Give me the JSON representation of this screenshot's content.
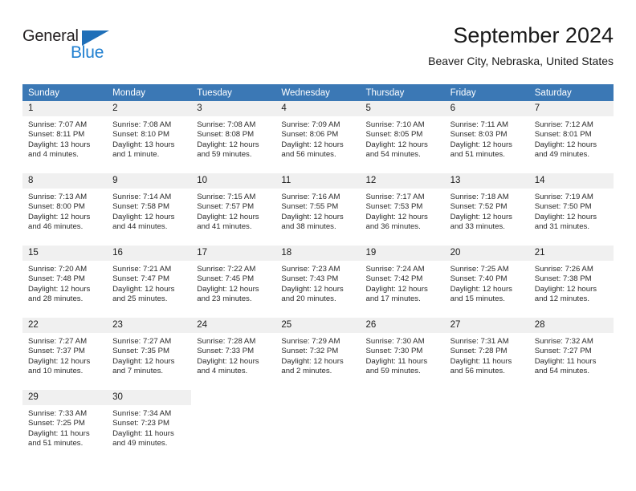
{
  "brand": {
    "name_part1": "General",
    "name_part2": "Blue",
    "triangle_icon": "blue-triangle-icon",
    "accent_color": "#1f7fd0"
  },
  "header": {
    "title": "September 2024",
    "subtitle": "Beaver City, Nebraska, United States"
  },
  "theme": {
    "header_row_bg": "#3b78b5",
    "daynum_band_bg": "#f0f0f0",
    "page_bg": "#ffffff",
    "text_color": "#1a1a1a"
  },
  "weekdays": [
    "Sunday",
    "Monday",
    "Tuesday",
    "Wednesday",
    "Thursday",
    "Friday",
    "Saturday"
  ],
  "calendar": {
    "weeks": [
      [
        {
          "day": "1",
          "sunrise": "Sunrise: 7:07 AM",
          "sunset": "Sunset: 8:11 PM",
          "daylight_line1": "Daylight: 13 hours",
          "daylight_line2": "and 4 minutes."
        },
        {
          "day": "2",
          "sunrise": "Sunrise: 7:08 AM",
          "sunset": "Sunset: 8:10 PM",
          "daylight_line1": "Daylight: 13 hours",
          "daylight_line2": "and 1 minute."
        },
        {
          "day": "3",
          "sunrise": "Sunrise: 7:08 AM",
          "sunset": "Sunset: 8:08 PM",
          "daylight_line1": "Daylight: 12 hours",
          "daylight_line2": "and 59 minutes."
        },
        {
          "day": "4",
          "sunrise": "Sunrise: 7:09 AM",
          "sunset": "Sunset: 8:06 PM",
          "daylight_line1": "Daylight: 12 hours",
          "daylight_line2": "and 56 minutes."
        },
        {
          "day": "5",
          "sunrise": "Sunrise: 7:10 AM",
          "sunset": "Sunset: 8:05 PM",
          "daylight_line1": "Daylight: 12 hours",
          "daylight_line2": "and 54 minutes."
        },
        {
          "day": "6",
          "sunrise": "Sunrise: 7:11 AM",
          "sunset": "Sunset: 8:03 PM",
          "daylight_line1": "Daylight: 12 hours",
          "daylight_line2": "and 51 minutes."
        },
        {
          "day": "7",
          "sunrise": "Sunrise: 7:12 AM",
          "sunset": "Sunset: 8:01 PM",
          "daylight_line1": "Daylight: 12 hours",
          "daylight_line2": "and 49 minutes."
        }
      ],
      [
        {
          "day": "8",
          "sunrise": "Sunrise: 7:13 AM",
          "sunset": "Sunset: 8:00 PM",
          "daylight_line1": "Daylight: 12 hours",
          "daylight_line2": "and 46 minutes."
        },
        {
          "day": "9",
          "sunrise": "Sunrise: 7:14 AM",
          "sunset": "Sunset: 7:58 PM",
          "daylight_line1": "Daylight: 12 hours",
          "daylight_line2": "and 44 minutes."
        },
        {
          "day": "10",
          "sunrise": "Sunrise: 7:15 AM",
          "sunset": "Sunset: 7:57 PM",
          "daylight_line1": "Daylight: 12 hours",
          "daylight_line2": "and 41 minutes."
        },
        {
          "day": "11",
          "sunrise": "Sunrise: 7:16 AM",
          "sunset": "Sunset: 7:55 PM",
          "daylight_line1": "Daylight: 12 hours",
          "daylight_line2": "and 38 minutes."
        },
        {
          "day": "12",
          "sunrise": "Sunrise: 7:17 AM",
          "sunset": "Sunset: 7:53 PM",
          "daylight_line1": "Daylight: 12 hours",
          "daylight_line2": "and 36 minutes."
        },
        {
          "day": "13",
          "sunrise": "Sunrise: 7:18 AM",
          "sunset": "Sunset: 7:52 PM",
          "daylight_line1": "Daylight: 12 hours",
          "daylight_line2": "and 33 minutes."
        },
        {
          "day": "14",
          "sunrise": "Sunrise: 7:19 AM",
          "sunset": "Sunset: 7:50 PM",
          "daylight_line1": "Daylight: 12 hours",
          "daylight_line2": "and 31 minutes."
        }
      ],
      [
        {
          "day": "15",
          "sunrise": "Sunrise: 7:20 AM",
          "sunset": "Sunset: 7:48 PM",
          "daylight_line1": "Daylight: 12 hours",
          "daylight_line2": "and 28 minutes."
        },
        {
          "day": "16",
          "sunrise": "Sunrise: 7:21 AM",
          "sunset": "Sunset: 7:47 PM",
          "daylight_line1": "Daylight: 12 hours",
          "daylight_line2": "and 25 minutes."
        },
        {
          "day": "17",
          "sunrise": "Sunrise: 7:22 AM",
          "sunset": "Sunset: 7:45 PM",
          "daylight_line1": "Daylight: 12 hours",
          "daylight_line2": "and 23 minutes."
        },
        {
          "day": "18",
          "sunrise": "Sunrise: 7:23 AM",
          "sunset": "Sunset: 7:43 PM",
          "daylight_line1": "Daylight: 12 hours",
          "daylight_line2": "and 20 minutes."
        },
        {
          "day": "19",
          "sunrise": "Sunrise: 7:24 AM",
          "sunset": "Sunset: 7:42 PM",
          "daylight_line1": "Daylight: 12 hours",
          "daylight_line2": "and 17 minutes."
        },
        {
          "day": "20",
          "sunrise": "Sunrise: 7:25 AM",
          "sunset": "Sunset: 7:40 PM",
          "daylight_line1": "Daylight: 12 hours",
          "daylight_line2": "and 15 minutes."
        },
        {
          "day": "21",
          "sunrise": "Sunrise: 7:26 AM",
          "sunset": "Sunset: 7:38 PM",
          "daylight_line1": "Daylight: 12 hours",
          "daylight_line2": "and 12 minutes."
        }
      ],
      [
        {
          "day": "22",
          "sunrise": "Sunrise: 7:27 AM",
          "sunset": "Sunset: 7:37 PM",
          "daylight_line1": "Daylight: 12 hours",
          "daylight_line2": "and 10 minutes."
        },
        {
          "day": "23",
          "sunrise": "Sunrise: 7:27 AM",
          "sunset": "Sunset: 7:35 PM",
          "daylight_line1": "Daylight: 12 hours",
          "daylight_line2": "and 7 minutes."
        },
        {
          "day": "24",
          "sunrise": "Sunrise: 7:28 AM",
          "sunset": "Sunset: 7:33 PM",
          "daylight_line1": "Daylight: 12 hours",
          "daylight_line2": "and 4 minutes."
        },
        {
          "day": "25",
          "sunrise": "Sunrise: 7:29 AM",
          "sunset": "Sunset: 7:32 PM",
          "daylight_line1": "Daylight: 12 hours",
          "daylight_line2": "and 2 minutes."
        },
        {
          "day": "26",
          "sunrise": "Sunrise: 7:30 AM",
          "sunset": "Sunset: 7:30 PM",
          "daylight_line1": "Daylight: 11 hours",
          "daylight_line2": "and 59 minutes."
        },
        {
          "day": "27",
          "sunrise": "Sunrise: 7:31 AM",
          "sunset": "Sunset: 7:28 PM",
          "daylight_line1": "Daylight: 11 hours",
          "daylight_line2": "and 56 minutes."
        },
        {
          "day": "28",
          "sunrise": "Sunrise: 7:32 AM",
          "sunset": "Sunset: 7:27 PM",
          "daylight_line1": "Daylight: 11 hours",
          "daylight_line2": "and 54 minutes."
        }
      ],
      [
        {
          "day": "29",
          "sunrise": "Sunrise: 7:33 AM",
          "sunset": "Sunset: 7:25 PM",
          "daylight_line1": "Daylight: 11 hours",
          "daylight_line2": "and 51 minutes."
        },
        {
          "day": "30",
          "sunrise": "Sunrise: 7:34 AM",
          "sunset": "Sunset: 7:23 PM",
          "daylight_line1": "Daylight: 11 hours",
          "daylight_line2": "and 49 minutes."
        },
        {
          "day": "",
          "sunrise": "",
          "sunset": "",
          "daylight_line1": "",
          "daylight_line2": ""
        },
        {
          "day": "",
          "sunrise": "",
          "sunset": "",
          "daylight_line1": "",
          "daylight_line2": ""
        },
        {
          "day": "",
          "sunrise": "",
          "sunset": "",
          "daylight_line1": "",
          "daylight_line2": ""
        },
        {
          "day": "",
          "sunrise": "",
          "sunset": "",
          "daylight_line1": "",
          "daylight_line2": ""
        },
        {
          "day": "",
          "sunrise": "",
          "sunset": "",
          "daylight_line1": "",
          "daylight_line2": ""
        }
      ]
    ]
  }
}
